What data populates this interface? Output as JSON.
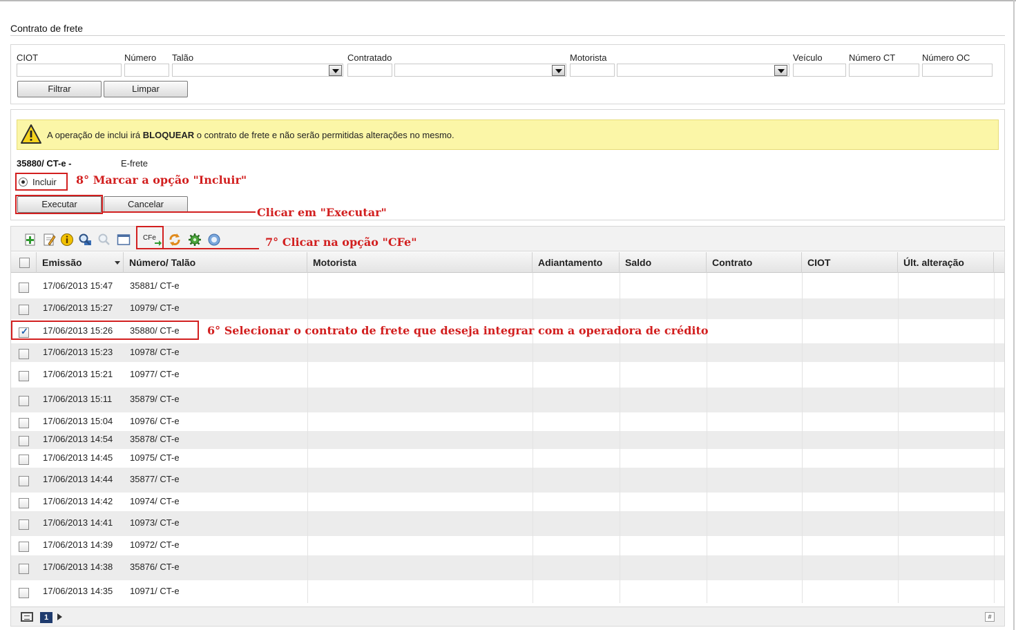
{
  "page_title": "Contrato de frete",
  "filters": {
    "labels": [
      "CIOT",
      "Número",
      "Talão",
      "Contratado",
      "Motorista",
      "Veículo",
      "Número CT",
      "Número OC"
    ],
    "filter_button": "Filtrar",
    "clear_button": "Limpar"
  },
  "warning": {
    "prefix": "A operação de inclui irá ",
    "bold": "BLOQUEAR",
    "suffix": " o contrato de frete e não serão permitidas alterações no mesmo."
  },
  "contract": {
    "id": "35880/ CT-e -",
    "operator": "E-frete",
    "option_label": "Incluir",
    "execute_button": "Executar",
    "cancel_button": "Cancelar"
  },
  "toolbar": {
    "cfe_label": "CFe",
    "icons": [
      "add-icon",
      "edit-icon",
      "info-icon",
      "search-icon",
      "zoom-icon",
      "window-icon",
      "cfe-icon",
      "refresh-icon",
      "settings-icon",
      "help-icon"
    ]
  },
  "grid": {
    "columns": [
      "Emissão",
      "Número/ Talão",
      "Motorista",
      "Adiantamento",
      "Saldo",
      "Contrato",
      "CIOT",
      "Últ. alteração"
    ],
    "rows": [
      {
        "emissao": "17/06/2013 15:47",
        "numero": "35881/ CT-e",
        "checked": false
      },
      {
        "emissao": "17/06/2013 15:27",
        "numero": "10979/ CT-e",
        "checked": false
      },
      {
        "emissao": "17/06/2013 15:26",
        "numero": "35880/ CT-e",
        "checked": true
      },
      {
        "emissao": "17/06/2013 15:23",
        "numero": "10978/ CT-e",
        "checked": false
      },
      {
        "emissao": "17/06/2013 15:21",
        "numero": "10977/ CT-e",
        "checked": false
      },
      {
        "emissao": "17/06/2013 15:11",
        "numero": "35879/ CT-e",
        "checked": false
      },
      {
        "emissao": "17/06/2013 15:04",
        "numero": "10976/ CT-e",
        "checked": false
      },
      {
        "emissao": "17/06/2013 14:54",
        "numero": "35878/ CT-e",
        "checked": false
      },
      {
        "emissao": "17/06/2013 14:45",
        "numero": "10975/ CT-e",
        "checked": false
      },
      {
        "emissao": "17/06/2013 14:44",
        "numero": "35877/ CT-e",
        "checked": false
      },
      {
        "emissao": "17/06/2013 14:42",
        "numero": "10974/ CT-e",
        "checked": false
      },
      {
        "emissao": "17/06/2013 14:41",
        "numero": "10973/ CT-e",
        "checked": false
      },
      {
        "emissao": "17/06/2013 14:39",
        "numero": "10972/ CT-e",
        "checked": false
      },
      {
        "emissao": "17/06/2013 14:38",
        "numero": "35876/ CT-e",
        "checked": false
      },
      {
        "emissao": "17/06/2013 14:35",
        "numero": "10971/ CT-e",
        "checked": false
      }
    ]
  },
  "pager": {
    "current_page": "1",
    "right_symbol": "#"
  },
  "annotations": {
    "step6": "6° Selecionar o contrato de frete que deseja integrar com a operadora de crédito",
    "step7": "7° Clicar na opção \"CFe\"",
    "step8": "8° Marcar a opção \"Incluir\"",
    "execute": "Clicar em \"Executar\""
  },
  "colors": {
    "annotation_red": "#d21f1f",
    "warning_bg": "#fbf6a7",
    "page_badge": "#1f3b6e"
  }
}
